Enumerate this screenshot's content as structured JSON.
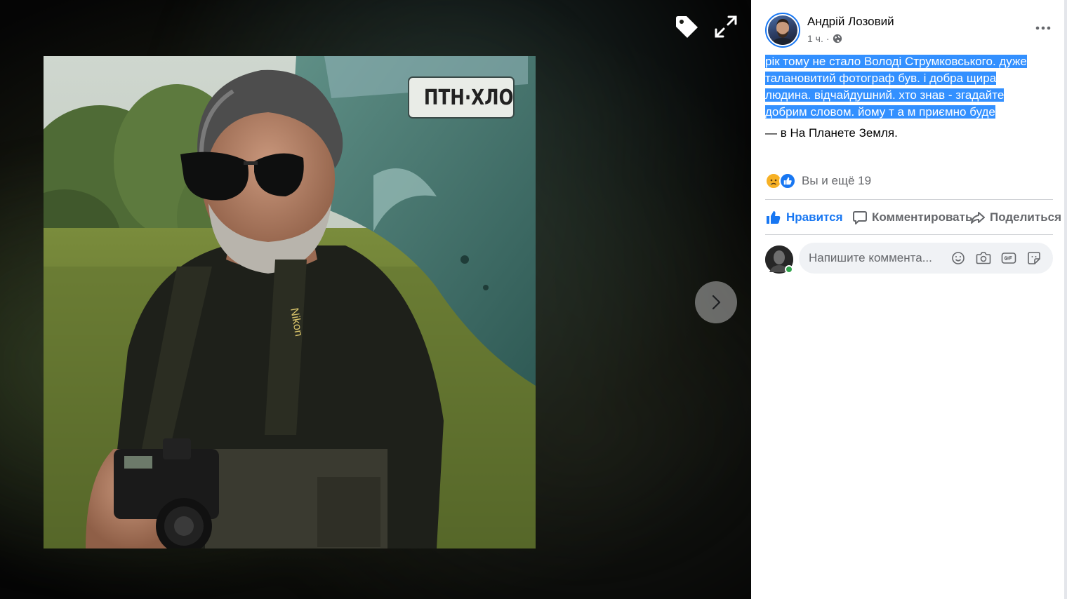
{
  "post": {
    "author": "Андрій Лозовий",
    "time": "1 ч.",
    "text_lines": [
      "рік тому не стало Володі Струмковського. дуже",
      "талановитий фотограф був. і добра щира",
      "людина. відчайдушний. хто знав - згадайте",
      "добрим словом. йому т а м приємно буде"
    ],
    "location_prefix": "— в",
    "location_name": "На Планете Земля",
    "location_suffix": ".",
    "reactions_text": "Вы и ещё 19"
  },
  "actions": {
    "like": "Нравится",
    "comment": "Комментировать",
    "share": "Поделиться"
  },
  "comment_box": {
    "placeholder": "Напишите коммента..."
  },
  "photo": {
    "plate_text": "ПТН·ХЛО",
    "strap_text": "Nikon"
  },
  "colors": {
    "accent": "#1877f2",
    "selection": "#3390ff",
    "online": "#31a24c"
  },
  "icons": [
    "tag-icon",
    "expand-icon",
    "chevron-right-icon",
    "globe-icon",
    "more-icon",
    "sad-reaction-icon",
    "like-reaction-icon",
    "thumbs-up-icon",
    "comment-icon",
    "share-icon",
    "emoji-icon",
    "camera-icon",
    "gif-icon",
    "sticker-icon"
  ]
}
